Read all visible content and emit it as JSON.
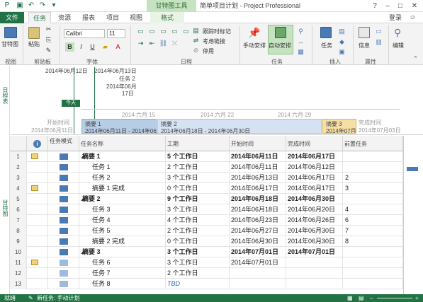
{
  "window": {
    "context_tab_group": "甘特图工具",
    "title": "简单项目计划 - Project Professional",
    "help": "?",
    "sign_in": "登录"
  },
  "tabs": [
    "文件",
    "任务",
    "资源",
    "报表",
    "项目",
    "视图",
    "格式"
  ],
  "ribbon": {
    "groups": {
      "view": "视图",
      "clipboard": "剪贴板",
      "font": "字体",
      "schedule": "日程",
      "tasks": "任务",
      "insert": "插入",
      "properties": "属性"
    },
    "gantt_button": "甘特图",
    "paste_button": "粘贴",
    "font_name": "Calibri",
    "font_size": "11",
    "bold": "B",
    "italic": "I",
    "underline": "U",
    "track_mark": "跟踪时标记",
    "respect_links": "考虑链接",
    "deactivate": "停用",
    "manual_schedule": "手动安排",
    "auto_schedule": "自动安排",
    "task_button": "任务",
    "info_button": "信息",
    "edit_button": "编辑"
  },
  "timeline": {
    "side_label": "日程表",
    "date_marker_1": "2014年06月12日",
    "date_marker_2": "2014年06月13日",
    "task2_label": "任务 2",
    "task2_date": "2014年06月",
    "task2_day": "17日",
    "today": "今天",
    "scale_ticks": [
      "2014 六月 15",
      "2014 六月 22",
      "2014 六月 29"
    ],
    "start_label": "开始时间",
    "start_date": "2014年06月11日",
    "finish_label": "完成时间",
    "finish_date": "2014年07月03日",
    "summaries": [
      {
        "name": "摘要 1",
        "range": "2014年06月11日 - 2014年06月17日"
      },
      {
        "name": "摘要 2",
        "range": "2014年06月18日 - 2014年06月30日"
      },
      {
        "name": "摘要 3",
        "range": "2014年07月0"
      }
    ]
  },
  "grid": {
    "side_label": "甘特图",
    "columns": [
      "任务模式",
      "任务名称",
      "工期",
      "开始时间",
      "完成时间",
      "前置任务"
    ],
    "rows": [
      {
        "id": "1",
        "note": true,
        "name": "摘要 1",
        "summary": true,
        "duration": "5 个工作日",
        "start": "2014年06月11日",
        "finish": "2014年06月17日",
        "pred": ""
      },
      {
        "id": "2",
        "note": false,
        "name": "任务 1",
        "summary": false,
        "duration": "2 个工作日",
        "start": "2014年06月11日",
        "finish": "2014年06月12日",
        "pred": ""
      },
      {
        "id": "3",
        "note": false,
        "name": "任务 2",
        "summary": false,
        "duration": "3 个工作日",
        "start": "2014年06月13日",
        "finish": "2014年06月17日",
        "pred": "2"
      },
      {
        "id": "4",
        "note": true,
        "name": "摘要 1 完成",
        "summary": false,
        "duration": "0 个工作日",
        "start": "2014年06月17日",
        "finish": "2014年06月17日",
        "pred": "3"
      },
      {
        "id": "5",
        "note": false,
        "name": "摘要 2",
        "summary": true,
        "duration": "9 个工作日",
        "start": "2014年06月18日",
        "finish": "2014年06月30日",
        "pred": ""
      },
      {
        "id": "6",
        "note": false,
        "name": "任务 3",
        "summary": false,
        "duration": "3 个工作日",
        "start": "2014年06月18日",
        "finish": "2014年06月20日",
        "pred": "4"
      },
      {
        "id": "7",
        "note": false,
        "name": "任务 4",
        "summary": false,
        "duration": "4 个工作日",
        "start": "2014年06月23日",
        "finish": "2014年06月26日",
        "pred": "6"
      },
      {
        "id": "8",
        "note": false,
        "name": "任务 5",
        "summary": false,
        "duration": "2 个工作日",
        "start": "2014年06月27日",
        "finish": "2014年06月30日",
        "pred": "7"
      },
      {
        "id": "9",
        "note": false,
        "name": "摘要 2 完成",
        "summary": false,
        "duration": "0 个工作日",
        "start": "2014年06月30日",
        "finish": "2014年06月30日",
        "pred": "8"
      },
      {
        "id": "10",
        "note": false,
        "name": "摘要 3",
        "summary": true,
        "duration": "3 个工作日",
        "start": "2014年07月01日",
        "finish": "2014年07月01日",
        "pred": ""
      },
      {
        "id": "11",
        "note": true,
        "name": "任务 6",
        "summary": false,
        "duration": "3 个工作日",
        "start": "2014年07月01日",
        "finish": "",
        "pred": ""
      },
      {
        "id": "12",
        "note": false,
        "name": "任务 7",
        "summary": false,
        "duration": "2 个工作日",
        "start": "",
        "finish": "",
        "pred": ""
      },
      {
        "id": "13",
        "note": false,
        "name": "任务 8",
        "summary": false,
        "duration": "TBD",
        "start": "",
        "finish": "",
        "pred": ""
      }
    ]
  },
  "status": {
    "ready": "就绪",
    "new_tasks": "新任务: 手动计划"
  },
  "colors": {
    "accent": "#217346",
    "timeline_bar1": "#b7cde6",
    "timeline_bar2": "#d4e2f2",
    "timeline_bar3": "#f6dfa4"
  }
}
